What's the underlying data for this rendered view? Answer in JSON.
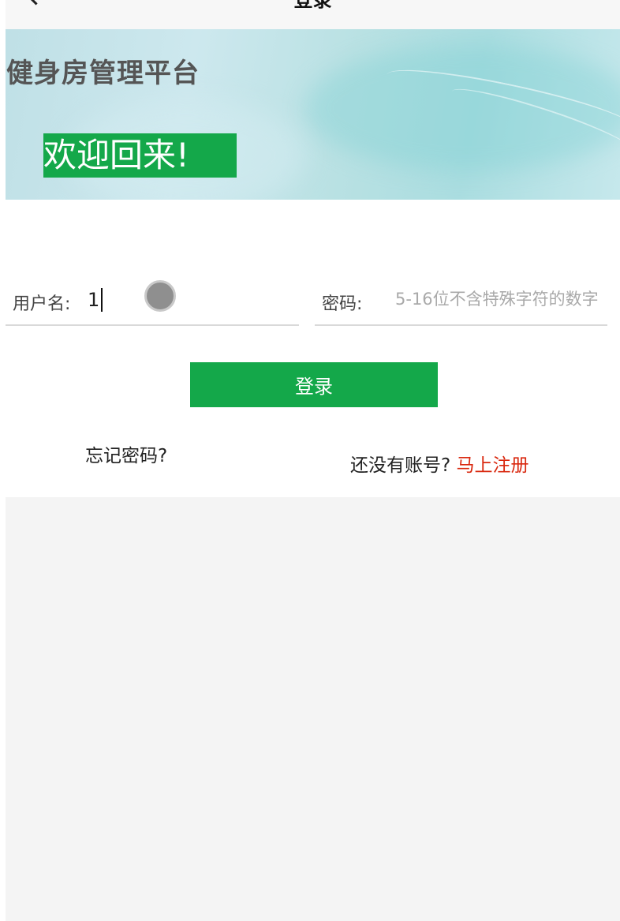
{
  "header": {
    "title": "登录",
    "back_icon": "chevron-left-icon"
  },
  "banner": {
    "app_name": "健身房管理平台",
    "welcome_text": "欢迎回来!"
  },
  "form": {
    "username_label": "用户名:",
    "username_value": "1",
    "password_label": "密码:",
    "password_placeholder": "5-16位不含特殊字符的数字",
    "login_button": "登录",
    "forgot_password": "忘记密码?",
    "no_account_text": "还没有账号?",
    "register_link": "马上注册"
  },
  "colors": {
    "accent_green": "#14a84a",
    "register_red": "#d9280f",
    "page_background": "#f4f4f4"
  }
}
